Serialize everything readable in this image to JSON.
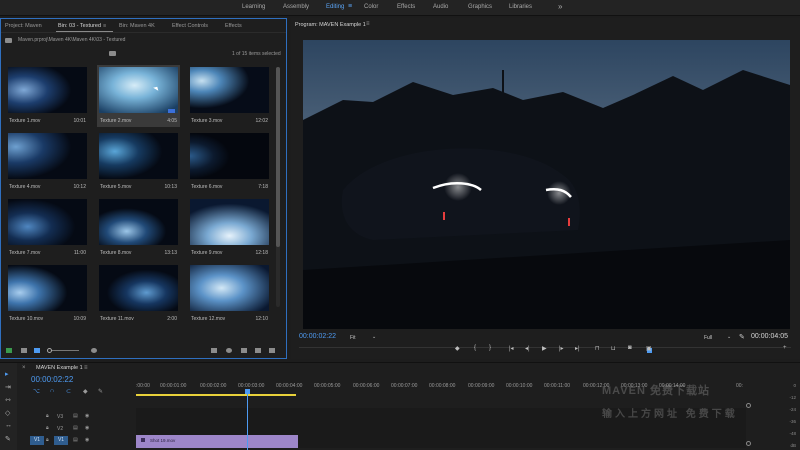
{
  "workspaces": [
    "Learning",
    "Assembly",
    "Editing",
    "Color",
    "Effects",
    "Audio",
    "Graphics",
    "Libraries"
  ],
  "active_workspace": "Editing",
  "project_panel": {
    "tabs": [
      "Project: Maven",
      "Bin: 03 - Textured",
      "Bin: Maven 4K",
      "Effect Controls",
      "Effects"
    ],
    "path": "Maven.prproj\\Maven 4K\\Maven 4K\\03 - Textured",
    "count": "1 of 15 items selected",
    "items": [
      {
        "name": "Texture 1.mov",
        "dur": "10:01"
      },
      {
        "name": "Texture 2.mov",
        "dur": "4:05"
      },
      {
        "name": "Texture 3.mov",
        "dur": "12:02"
      },
      {
        "name": "Texture 4.mov",
        "dur": "10:12"
      },
      {
        "name": "Texture 5.mov",
        "dur": "10:13"
      },
      {
        "name": "Texture 6.mov",
        "dur": "7:18"
      },
      {
        "name": "Texture 7.mov",
        "dur": "11:00"
      },
      {
        "name": "Texture 8.mov",
        "dur": "13:13"
      },
      {
        "name": "Texture 9.mov",
        "dur": "12:18"
      },
      {
        "name": "Texture 10.mov",
        "dur": "10:09"
      },
      {
        "name": "Texture 11.mov",
        "dur": "2:00"
      },
      {
        "name": "Texture 12.mov",
        "dur": "12:10"
      }
    ]
  },
  "program": {
    "title": "Program: MAVEN Example 1",
    "timecode_current": "00:00:02:22",
    "fit_label": "Fit",
    "resolution": "Full",
    "timecode_duration": "00:00:04:05"
  },
  "timeline": {
    "sequence_title": "MAVEN Example 1",
    "timecode": "00:00:02:22",
    "ruler": [
      ":00:00",
      "00:00:01:00",
      "00:00:02:00",
      "00:00:03:00",
      "00:00:04:00",
      "00:00:05:00",
      "00:00:06:00",
      "00:00:07:00",
      "00:00:08:00",
      "00:00:09:00",
      "00:00:10:00",
      "00:00:11:00",
      "00:00:12:00",
      "00:00:13:00",
      "00:00:14:00",
      "00:"
    ],
    "tracks": [
      "V3",
      "V2",
      "V1"
    ],
    "source_patch": "V1",
    "clip_label": "Shot 19.mov",
    "meter_labels": [
      "0",
      "-12",
      "-24",
      "-36",
      "-48",
      "dB"
    ]
  },
  "watermark": {
    "line1": "MAVEN 免费下载站",
    "line2": "输入上方网址 免费下载"
  }
}
